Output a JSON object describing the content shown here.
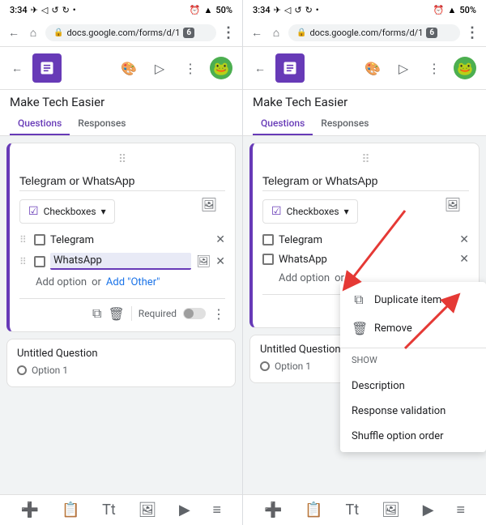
{
  "status_bar": {
    "time_left": "3:34",
    "time_right": "3:34",
    "battery": "50%"
  },
  "browser": {
    "url": "docs.google.com/forms/d/1",
    "tab_count": "6"
  },
  "app": {
    "title": "Make Tech Easier",
    "tabs": [
      "Questions",
      "Responses"
    ],
    "active_tab": "Questions"
  },
  "left_panel": {
    "question": {
      "title": "Telegram or WhatsApp",
      "type": "Checkboxes",
      "options": [
        "Telegram",
        "WhatsApp"
      ],
      "active_option_index": 1,
      "add_option_text": "Add option",
      "add_other_text": "Add \"Other\"",
      "footer": {
        "required_label": "Required"
      }
    },
    "untitled": {
      "title": "Untitled Question",
      "option": "Option 1"
    }
  },
  "right_panel": {
    "question": {
      "title": "Telegram or WhatsApp",
      "type": "Checkboxes",
      "options": [
        "Telegram",
        "WhatsApp"
      ],
      "add_option_text": "Add option",
      "add_other_text": "or"
    },
    "untitled": {
      "title": "Untitled Question",
      "option": "Option 1"
    },
    "context_menu": {
      "section1": {
        "items": [
          {
            "label": "Duplicate item",
            "icon": "⧉"
          },
          {
            "label": "Remove",
            "icon": "🗑"
          }
        ]
      },
      "section2_header": "Show",
      "section2": {
        "items": [
          {
            "label": "Description"
          },
          {
            "label": "Response validation"
          },
          {
            "label": "Shuffle option order"
          }
        ]
      }
    }
  },
  "bottom_toolbar": {
    "icons": [
      "➕",
      "📋",
      "Tt",
      "🖼",
      "▶",
      "≡"
    ]
  }
}
